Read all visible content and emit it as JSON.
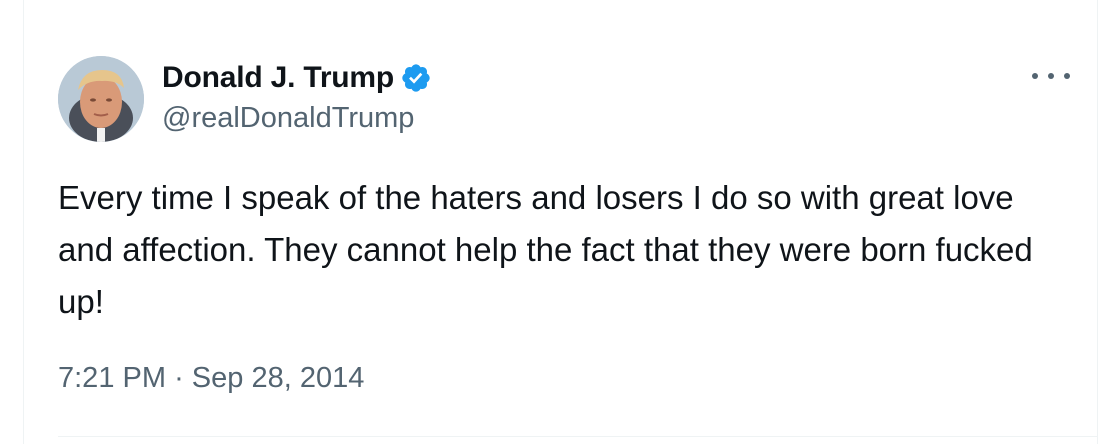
{
  "author": {
    "display_name": "Donald J. Trump",
    "handle": "@realDonaldTrump",
    "verified_icon": "verified-badge-icon",
    "avatar_icon": "profile-photo"
  },
  "tweet": {
    "text": "Every time I speak of the haters and losers I do so with great love and affection. They cannot help the fact that they were born fucked up!",
    "time": "7:21 PM",
    "separator": "·",
    "date": "Sep 28, 2014"
  },
  "menu": {
    "icon": "more-options-icon"
  },
  "colors": {
    "text_primary": "#0f1419",
    "text_secondary": "#536471",
    "verified_blue": "#1d9bf0",
    "divider": "#eff3f4"
  }
}
